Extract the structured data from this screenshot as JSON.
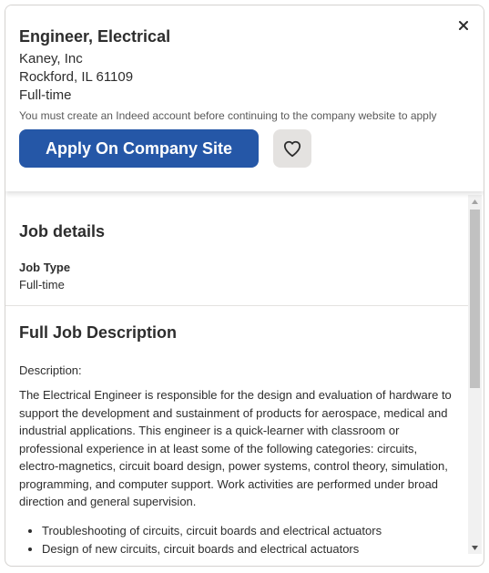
{
  "job": {
    "title": "Engineer, Electrical",
    "company": "Kaney, Inc",
    "location": "Rockford, IL 61109",
    "job_type": "Full-time",
    "notice": "You must create an Indeed account before continuing to the company website to apply"
  },
  "actions": {
    "apply_label": "Apply On Company Site",
    "close_icon": "close-icon",
    "save_icon": "heart-icon"
  },
  "details": {
    "heading": "Job details",
    "job_type_label": "Job Type",
    "job_type_value": "Full-time"
  },
  "description": {
    "heading": "Full Job Description",
    "label": "Description:",
    "paragraph": "The Electrical Engineer is responsible for the design and evaluation of hardware to support the development and sustainment of products for aerospace, medical and industrial applications. This engineer is a quick-learner with classroom or professional experience in at least some of the following categories: circuits, electro-magnetics, circuit board design, power systems, control theory, simulation, programming, and computer support. Work activities are performed under broad direction and general supervision.",
    "bullets": [
      "Troubleshooting of circuits, circuit boards and electrical actuators",
      "Design of new circuits, circuit boards and electrical actuators"
    ]
  },
  "colors": {
    "accent": "#2557a7",
    "save_bg": "#e4e2e0"
  }
}
